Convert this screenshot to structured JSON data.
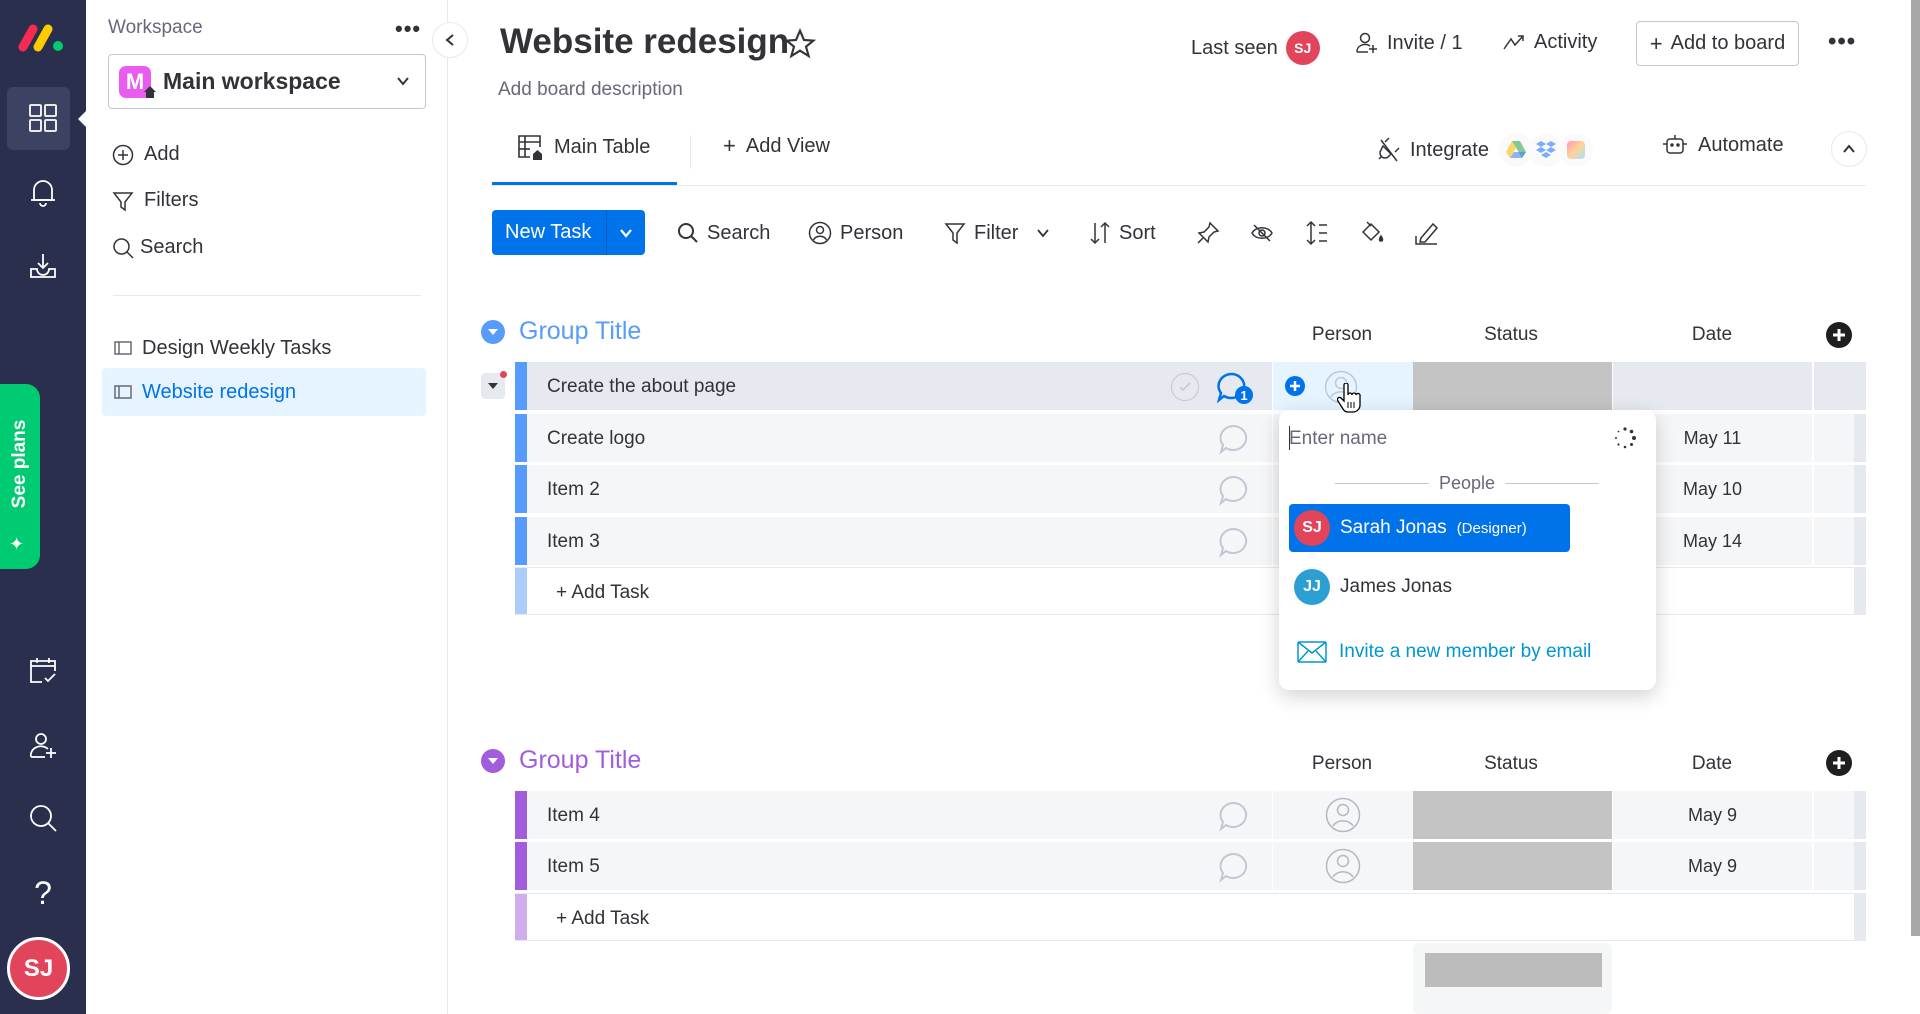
{
  "app": {
    "brand_colors": {
      "nav_bg": "#292f4c",
      "primary": "#0073ea",
      "see_plans": "#00ca72",
      "avatar_red": "#e2445c",
      "avatar_blue": "#2b9ed4",
      "group1": "#579bfc",
      "group2": "#a25ddc"
    }
  },
  "leftnav": {
    "icons": [
      "monday-logo-icon",
      "apps-grid-icon",
      "bell-icon",
      "inbox-download-icon",
      "calendar-check-icon",
      "invite-user-icon",
      "search-icon",
      "help-icon"
    ],
    "see_plans_label": "See plans",
    "avatar_initials": "SJ"
  },
  "workspace": {
    "label": "Workspace",
    "more": "•••",
    "name": "Main workspace",
    "badge_letter": "M",
    "actions": [
      {
        "icon": "plus-circle-icon",
        "label": "Add"
      },
      {
        "icon": "filter-icon",
        "label": "Filters"
      },
      {
        "icon": "search-icon",
        "label": "Search"
      }
    ],
    "boards": [
      {
        "label": "Design Weekly Tasks",
        "selected": false
      },
      {
        "label": "Website redesign",
        "selected": true
      }
    ]
  },
  "header": {
    "title": "Website redesign",
    "description": "Add board description",
    "last_seen_label": "Last seen",
    "last_seen_initials": "SJ",
    "invite_label": "Invite / 1",
    "activity_label": "Activity",
    "add_to_board_label": "Add to board",
    "more": "•••"
  },
  "tabs": {
    "main_table": "Main Table",
    "add_view": "Add View",
    "integrate": "Integrate",
    "automate": "Automate"
  },
  "toolbar": {
    "new_task": "New Task",
    "search": "Search",
    "person": "Person",
    "filter": "Filter",
    "sort": "Sort",
    "icon_buttons": [
      "pin-icon",
      "hide-icon",
      "row-height-icon",
      "color-fill-icon",
      "edit-icon"
    ]
  },
  "groups": [
    {
      "title": "Group Title",
      "color": "#579bfc",
      "columns": [
        "Person",
        "Status",
        "Date"
      ],
      "rows": [
        {
          "name": "Create the about page",
          "date": "",
          "comments": "1",
          "highlighted": true
        },
        {
          "name": "Create logo",
          "date": "May 11"
        },
        {
          "name": "Item 2",
          "date": "May 10"
        },
        {
          "name": "Item 3",
          "date": "May 14"
        }
      ],
      "add_task": "+ Add Task"
    },
    {
      "title": "Group Title",
      "color": "#a25ddc",
      "columns": [
        "Person",
        "Status",
        "Date"
      ],
      "rows": [
        {
          "name": "Item 4",
          "date": "May 9"
        },
        {
          "name": "Item 5",
          "date": "May 9"
        }
      ],
      "add_task": "+ Add Task"
    }
  ],
  "person_picker": {
    "placeholder": "Enter name",
    "section": "People",
    "options": [
      {
        "initials": "SJ",
        "name": "Sarah Jonas",
        "role": "(Designer)",
        "color": "#e2445c",
        "active": true
      },
      {
        "initials": "JJ",
        "name": "James Jonas",
        "role": "",
        "color": "#2b9ed4",
        "active": false
      }
    ],
    "invite_label": "Invite a new member by email"
  }
}
